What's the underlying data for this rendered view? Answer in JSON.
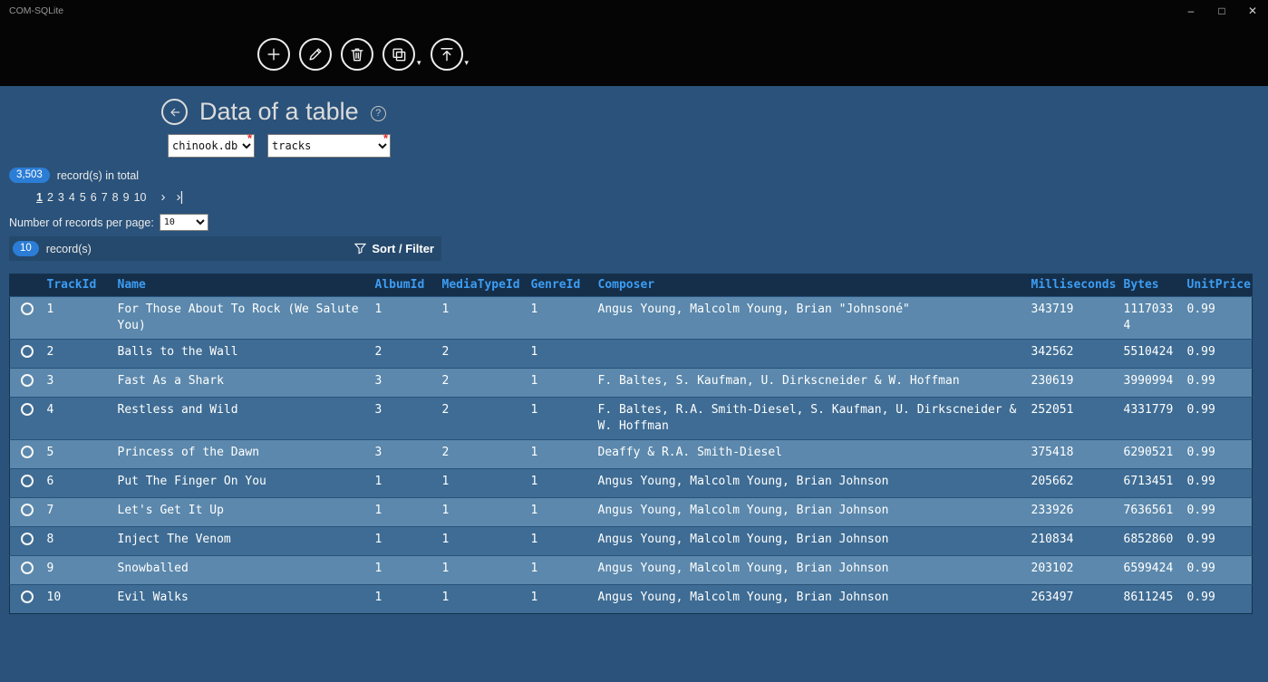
{
  "window": {
    "title": "COM-SQLite",
    "minimize": "–",
    "maximize": "□",
    "close": "✕"
  },
  "toolbar": {
    "buttons": [
      {
        "name": "add-record",
        "icon": "plus-icon"
      },
      {
        "name": "edit-record",
        "icon": "pencil-icon"
      },
      {
        "name": "delete-record",
        "icon": "trash-icon"
      },
      {
        "name": "copy-record",
        "icon": "copy-icon",
        "has_dropdown": true
      },
      {
        "name": "export-record",
        "icon": "upload-icon",
        "has_dropdown": true
      }
    ],
    "dropdown_caret": "▾"
  },
  "page": {
    "title": "Data of a table",
    "help_icon": "?",
    "database_select": {
      "value": "chinook.db",
      "required_marker": "*"
    },
    "table_select": {
      "value": "tracks",
      "required_marker": "*"
    },
    "total": {
      "badge": "3,503",
      "label": "record(s) in total"
    },
    "pagination": {
      "pages": [
        "1",
        "2",
        "3",
        "4",
        "5",
        "6",
        "7",
        "8",
        "9",
        "10"
      ],
      "current": "1",
      "next_icon": "›",
      "last_icon": "›|"
    },
    "per_page": {
      "label": "Number of records per page:",
      "value": "10"
    },
    "records_bar": {
      "badge": "10",
      "label": "record(s)",
      "sort_filter": "Sort / Filter"
    }
  },
  "table": {
    "columns": [
      "TrackId",
      "Name",
      "AlbumId",
      "MediaTypeId",
      "GenreId",
      "Composer",
      "Milliseconds",
      "Bytes",
      "UnitPrice"
    ],
    "rows": [
      {
        "TrackId": "1",
        "Name": "For Those About To Rock (We Salute You)",
        "AlbumId": "1",
        "MediaTypeId": "1",
        "GenreId": "1",
        "Composer": "Angus Young, Malcolm Young, Brian \"Johnsoné\"",
        "Milliseconds": "343719",
        "Bytes": "11170334",
        "UnitPrice": "0.99"
      },
      {
        "TrackId": "2",
        "Name": "Balls to the Wall",
        "AlbumId": "2",
        "MediaTypeId": "2",
        "GenreId": "1",
        "Composer": "",
        "Milliseconds": "342562",
        "Bytes": "5510424",
        "UnitPrice": "0.99"
      },
      {
        "TrackId": "3",
        "Name": "Fast As a Shark",
        "AlbumId": "3",
        "MediaTypeId": "2",
        "GenreId": "1",
        "Composer": "F. Baltes, S. Kaufman, U. Dirkscneider & W. Hoffman",
        "Milliseconds": "230619",
        "Bytes": "3990994",
        "UnitPrice": "0.99"
      },
      {
        "TrackId": "4",
        "Name": "Restless and Wild",
        "AlbumId": "3",
        "MediaTypeId": "2",
        "GenreId": "1",
        "Composer": "F. Baltes, R.A. Smith-Diesel, S. Kaufman, U. Dirkscneider & W. Hoffman",
        "Milliseconds": "252051",
        "Bytes": "4331779",
        "UnitPrice": "0.99"
      },
      {
        "TrackId": "5",
        "Name": "Princess of the Dawn",
        "AlbumId": "3",
        "MediaTypeId": "2",
        "GenreId": "1",
        "Composer": "Deaffy & R.A. Smith-Diesel",
        "Milliseconds": "375418",
        "Bytes": "6290521",
        "UnitPrice": "0.99"
      },
      {
        "TrackId": "6",
        "Name": "Put The Finger On You",
        "AlbumId": "1",
        "MediaTypeId": "1",
        "GenreId": "1",
        "Composer": "Angus Young, Malcolm Young, Brian Johnson",
        "Milliseconds": "205662",
        "Bytes": "6713451",
        "UnitPrice": "0.99"
      },
      {
        "TrackId": "7",
        "Name": "Let's Get It Up",
        "AlbumId": "1",
        "MediaTypeId": "1",
        "GenreId": "1",
        "Composer": "Angus Young, Malcolm Young, Brian Johnson",
        "Milliseconds": "233926",
        "Bytes": "7636561",
        "UnitPrice": "0.99"
      },
      {
        "TrackId": "8",
        "Name": "Inject The Venom",
        "AlbumId": "1",
        "MediaTypeId": "1",
        "GenreId": "1",
        "Composer": "Angus Young, Malcolm Young, Brian Johnson",
        "Milliseconds": "210834",
        "Bytes": "6852860",
        "UnitPrice": "0.99"
      },
      {
        "TrackId": "9",
        "Name": "Snowballed",
        "AlbumId": "1",
        "MediaTypeId": "1",
        "GenreId": "1",
        "Composer": "Angus Young, Malcolm Young, Brian Johnson",
        "Milliseconds": "203102",
        "Bytes": "6599424",
        "UnitPrice": "0.99"
      },
      {
        "TrackId": "10",
        "Name": "Evil Walks",
        "AlbumId": "1",
        "MediaTypeId": "1",
        "GenreId": "1",
        "Composer": "Angus Young, Malcolm Young, Brian Johnson",
        "Milliseconds": "263497",
        "Bytes": "8611245",
        "UnitPrice": "0.99"
      }
    ]
  },
  "colors": {
    "background": "#2a527a",
    "titlebar": "#050505",
    "badge_accent": "#2b7dd6",
    "table_header_bg": "#152f4a",
    "table_header_text": "#3d9df3",
    "row_light": "#5b88ac",
    "row_dark": "#3e6c94",
    "required_marker": "#e02b2b"
  }
}
